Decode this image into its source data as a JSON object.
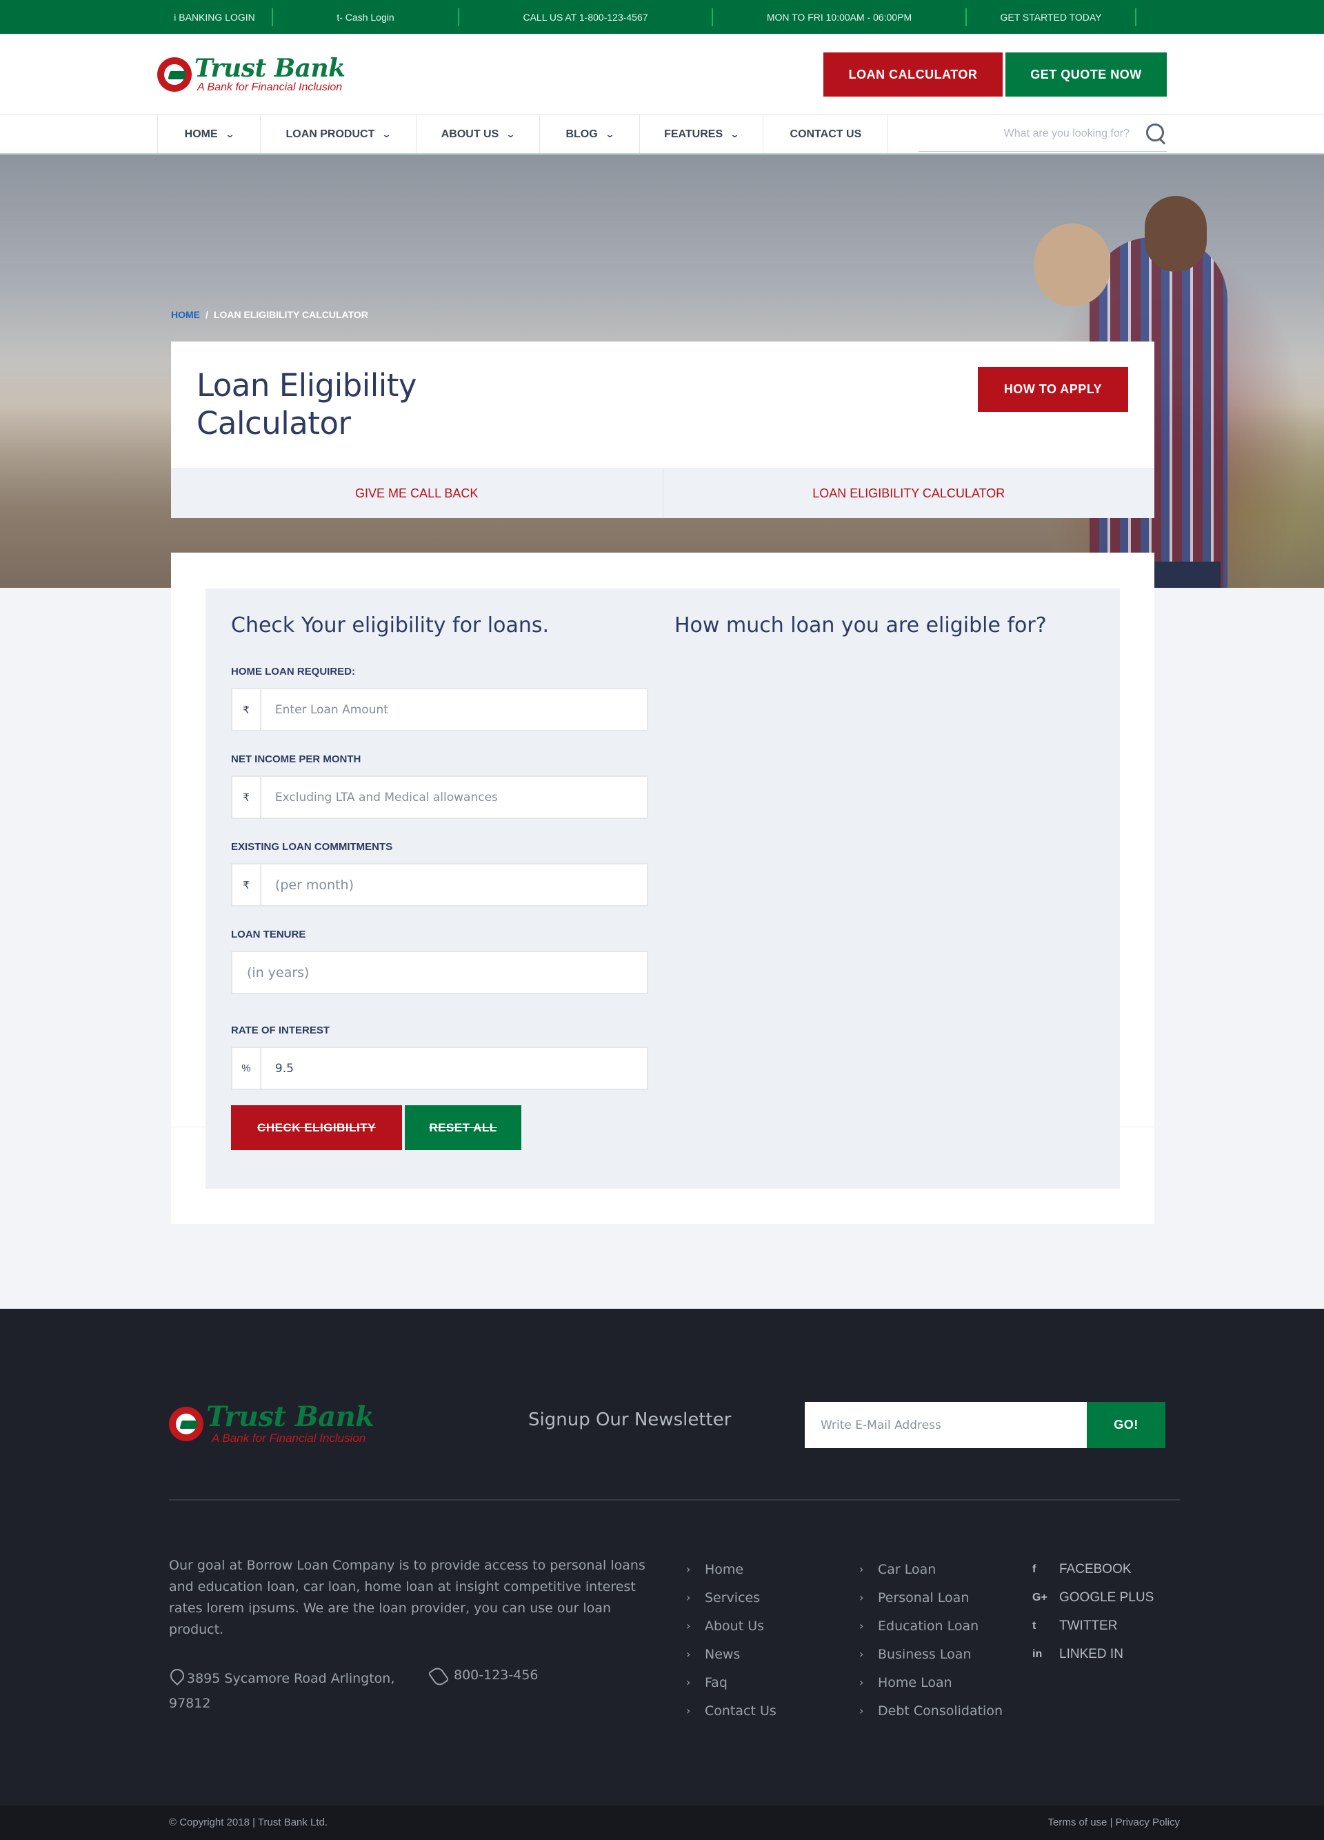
{
  "topbar": {
    "items": [
      {
        "label": "i BANKING LOGIN"
      },
      {
        "label": "t- Cash Login"
      },
      {
        "label": "CALL US AT 1-800-123-4567"
      },
      {
        "label": "MON TO FRI 10:00AM - 06:00PM"
      },
      {
        "label": "GET STARTED TODAY"
      }
    ]
  },
  "brand": {
    "name": "Trust Bank",
    "tagline": "A Bank for Financial Inclusion"
  },
  "header": {
    "loan_calculator_label": "LOAN CALCULATOR",
    "get_quote_label": "GET QUOTE NOW"
  },
  "nav": {
    "items": [
      {
        "label": "HOME"
      },
      {
        "label": "LOAN PRODUCT"
      },
      {
        "label": "ABOUT US"
      },
      {
        "label": "BLOG"
      },
      {
        "label": "FEATURES"
      },
      {
        "label": "CONTACT US"
      }
    ],
    "search_placeholder": "What are you looking for?"
  },
  "breadcrumb": {
    "home": "HOME",
    "separator": "/",
    "current": "LOAN ELIGIBILITY CALCULATOR"
  },
  "page": {
    "title": "Loan Eligibility Calculator",
    "apply_label": "HOW TO APPLY",
    "tabs": [
      {
        "label": "GIVE ME CALL BACK"
      },
      {
        "label": "LOAN ELIGIBILITY CALCULATOR"
      }
    ]
  },
  "form": {
    "heading_left": "Check Your eligibility for loans.",
    "heading_right": "How much loan you are eligible for?",
    "fields": [
      {
        "label": "HOME LOAN REQUIRED:",
        "prefix": "₹",
        "placeholder": "Enter Loan Amount",
        "value": ""
      },
      {
        "label": "NET INCOME PER MONTH",
        "prefix": "₹",
        "placeholder": "Excluding LTA and Medical allowances",
        "value": ""
      },
      {
        "label": "EXISTING LOAN COMMITMENTS",
        "prefix": "₹",
        "placeholder": "(per month)",
        "value": ""
      },
      {
        "label": "LOAN TENURE",
        "prefix": "",
        "placeholder": "(in years)",
        "value": ""
      },
      {
        "label": "RATE OF INTEREST",
        "prefix": "%",
        "placeholder": "",
        "value": "9.5"
      }
    ],
    "check_label": "CHECK ELIGIBILITY",
    "reset_label": "RESET ALL"
  },
  "footer": {
    "newsletter_title": "Signup Our Newsletter",
    "email_placeholder": "Write E-Mail Address",
    "go_label": "GO!",
    "about": "Our goal at Borrow Loan Company is to provide access to personal loans and education loan, car loan, home loan at insight competitive interest rates lorem ipsums. We are the loan provider, you can use our loan product.",
    "address": "3895 Sycamore Road Arlington, 97812",
    "phone": "800-123-456",
    "links_col1": [
      "Home",
      "Services",
      "About Us",
      "News",
      "Faq",
      "Contact Us"
    ],
    "links_col2": [
      "Car Loan",
      "Personal Loan",
      "Education Loan",
      "Business Loan",
      "Home Loan",
      "Debt Consolidation"
    ],
    "social": [
      {
        "icon": "facebook-icon",
        "glyph": "f",
        "label": "FACEBOOK"
      },
      {
        "icon": "google-plus-icon",
        "glyph": "G+",
        "label": "GOOGLE PLUS"
      },
      {
        "icon": "twitter-icon",
        "glyph": "t",
        "label": "TWITTER"
      },
      {
        "icon": "linkedin-icon",
        "glyph": "in",
        "label": "LINKED IN"
      }
    ],
    "copyright": "© Copyright 2018 | Trust Bank Ltd.",
    "terms": "Terms of use",
    "privacy": "Privacy Policy",
    "legal_separator": "|"
  },
  "colors": {
    "brand_green": "#006f3e",
    "brand_red": "#b5121b",
    "footer_bg": "#1e2129"
  }
}
